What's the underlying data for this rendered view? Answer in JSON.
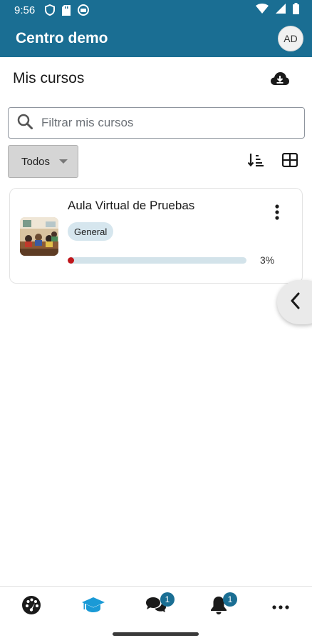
{
  "status_bar": {
    "time": "9:56"
  },
  "app_bar": {
    "title": "Centro demo",
    "avatar_initials": "AD"
  },
  "page": {
    "title": "Mis cursos"
  },
  "search": {
    "placeholder": "Filtrar mis cursos",
    "value": ""
  },
  "filter": {
    "selected": "Todos"
  },
  "courses": [
    {
      "title": "Aula Virtual de Pruebas",
      "category": "General",
      "progress_label": "3%",
      "progress_fraction": 0.03
    }
  ],
  "bottom_nav": {
    "messages_badge": "1",
    "notifications_badge": "1"
  },
  "colors": {
    "primary": "#1a6e93",
    "active_nav": "#1a9ad6",
    "progress_fill": "#c0161b",
    "badge_bg": "#d6e6ee"
  }
}
